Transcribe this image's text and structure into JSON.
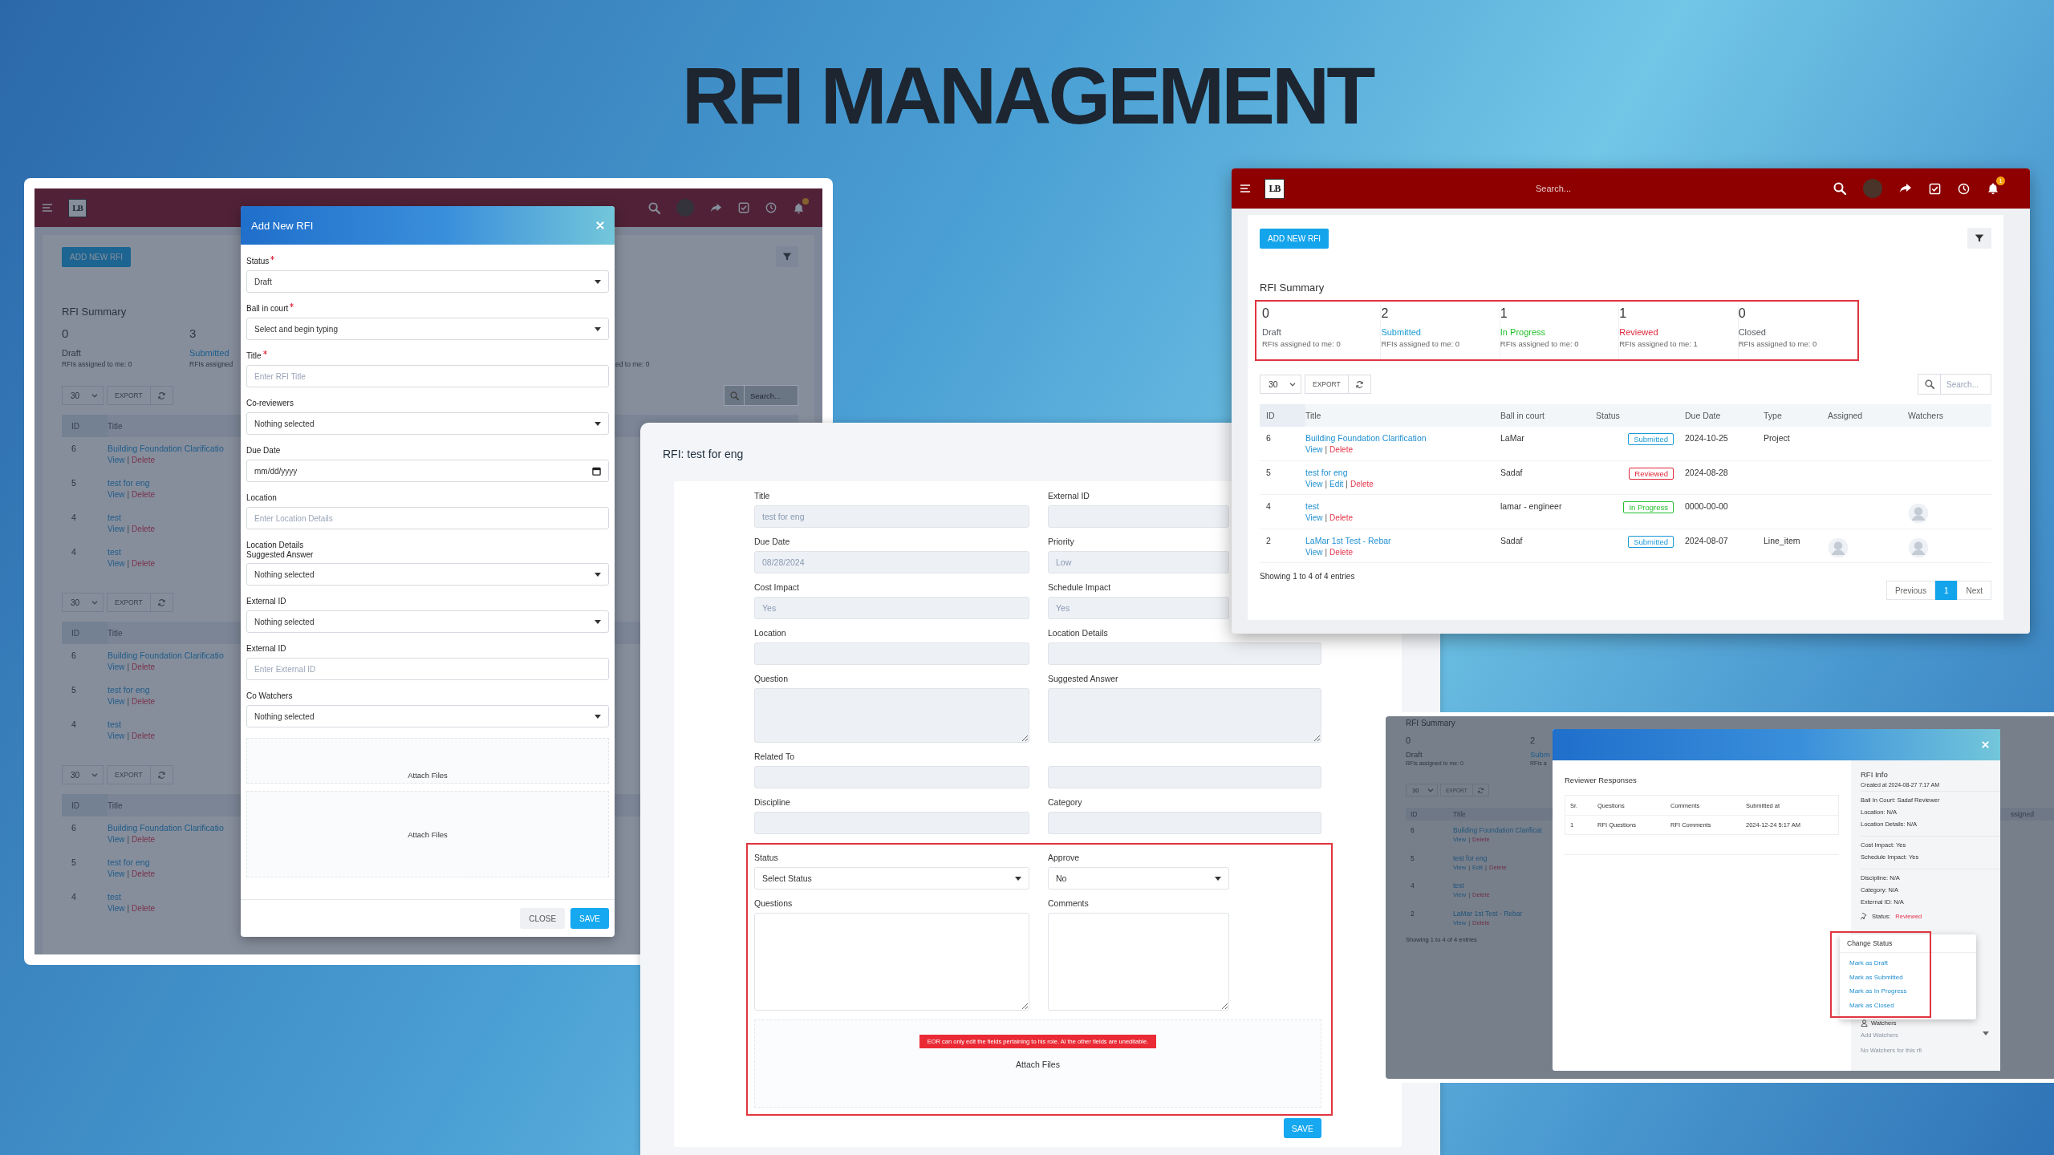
{
  "heading": "RFI MANAGEMENT",
  "add_rfi_window": {
    "header": {
      "logo": "LB"
    },
    "page": {
      "add_button": "ADD NEW RFI",
      "summary_title": "RFI Summary",
      "summary": [
        {
          "count": "0",
          "label": "Draft",
          "assigned": "RFIs assigned to me: 0",
          "color": "#2f3742"
        },
        {
          "count": "3",
          "label": "Submitted",
          "assigned": "RFIs assigned",
          "color": "#1d5c8a"
        }
      ],
      "summary_fragment": "ed to me: 0",
      "tables": [
        {
          "page_size": "30",
          "export": "EXPORT",
          "search_placeholder": "Search...",
          "columns": [
            "ID",
            "Title"
          ],
          "rows": [
            {
              "id": "6",
              "title": "Building Foundation Clarificatio",
              "actions": [
                {
                  "label": "View",
                  "kind": "view"
                },
                {
                  "label": "|",
                  "kind": "separator"
                },
                {
                  "label": "Delete",
                  "kind": "delete"
                }
              ]
            },
            {
              "id": "5",
              "title": "test for eng",
              "actions": [
                {
                  "label": "View",
                  "kind": "view"
                },
                {
                  "label": "|",
                  "kind": "separator"
                },
                {
                  "label": "Delete",
                  "kind": "delete"
                }
              ]
            },
            {
              "id": "4",
              "title": "test",
              "actions": [
                {
                  "label": "View",
                  "kind": "view"
                },
                {
                  "label": "|",
                  "kind": "separator"
                },
                {
                  "label": "Delete",
                  "kind": "delete"
                }
              ]
            },
            {
              "id": "4",
              "title": "test",
              "actions": [
                {
                  "label": "View",
                  "kind": "view"
                },
                {
                  "label": "|",
                  "kind": "separator"
                },
                {
                  "label": "Delete",
                  "kind": "delete"
                }
              ]
            }
          ]
        },
        {
          "page_size": "30",
          "export": "EXPORT",
          "columns": [
            "ID",
            "Title"
          ],
          "rows": [
            {
              "id": "6",
              "title": "Building Foundation Clarificatio",
              "actions": [
                {
                  "label": "View",
                  "kind": "view"
                },
                {
                  "label": "|",
                  "kind": "separator"
                },
                {
                  "label": "Delete",
                  "kind": "delete"
                }
              ]
            },
            {
              "id": "5",
              "title": "test for eng",
              "actions": [
                {
                  "label": "View",
                  "kind": "view"
                },
                {
                  "label": "|",
                  "kind": "separator"
                },
                {
                  "label": "Delete",
                  "kind": "delete"
                }
              ]
            },
            {
              "id": "4",
              "title": "test",
              "actions": [
                {
                  "label": "View",
                  "kind": "view"
                },
                {
                  "label": "|",
                  "kind": "separator"
                },
                {
                  "label": "Delete",
                  "kind": "delete"
                }
              ]
            }
          ]
        },
        {
          "page_size": "30",
          "export": "EXPORT",
          "columns": [
            "ID",
            "Title"
          ],
          "rows": [
            {
              "id": "6",
              "title": "Building Foundation Clarificatio",
              "actions": [
                {
                  "label": "View",
                  "kind": "view"
                },
                {
                  "label": "|",
                  "kind": "separator"
                },
                {
                  "label": "Delete",
                  "kind": "delete"
                }
              ]
            },
            {
              "id": "5",
              "title": "test for eng",
              "actions": [
                {
                  "label": "View",
                  "kind": "view"
                },
                {
                  "label": "|",
                  "kind": "separator"
                },
                {
                  "label": "Delete",
                  "kind": "delete"
                }
              ]
            },
            {
              "id": "4",
              "title": "test",
              "actions": [
                {
                  "label": "View",
                  "kind": "view"
                },
                {
                  "label": "|",
                  "kind": "separator"
                },
                {
                  "label": "Delete",
                  "kind": "delete"
                }
              ]
            }
          ]
        }
      ]
    },
    "modal": {
      "title": "Add New RFI",
      "fields": [
        {
          "kind": "select",
          "label": "Status",
          "required": true,
          "value": "Draft"
        },
        {
          "kind": "select",
          "label": "Ball in court",
          "required": true,
          "value": "Select and begin typing"
        },
        {
          "kind": "input",
          "label": "Title",
          "required": true,
          "placeholder": "Enter RFI Title"
        },
        {
          "kind": "select",
          "label": "Co-reviewers",
          "value": "Nothing selected"
        },
        {
          "kind": "date",
          "label": "Due Date",
          "value": "mm/dd/yyyy"
        },
        {
          "kind": "input",
          "label": "Location",
          "placeholder": "Enter Location Details"
        },
        {
          "kind": "select",
          "label": "Location Details",
          "extra_label": "Suggested Answer",
          "value": "Nothing selected"
        },
        {
          "kind": "select",
          "label": "External ID",
          "value": "Nothing selected"
        },
        {
          "kind": "input",
          "label": "External ID",
          "placeholder": "Enter External ID"
        },
        {
          "kind": "select",
          "label": "Co Watchers",
          "value": "Nothing selected"
        }
      ],
      "attachments": [
        "Attach Files",
        "Attach Files"
      ],
      "buttons": [
        {
          "label": "CLOSE",
          "kind": "secondary"
        },
        {
          "label": "SAVE",
          "kind": "primary"
        }
      ]
    }
  },
  "form_panel": {
    "title": "RFI: test for eng",
    "fields": [
      {
        "kind": "input",
        "label": "Title",
        "value": "test for eng",
        "disabled": true
      },
      {
        "kind": "input",
        "label": "External ID",
        "disabled": true
      },
      {
        "kind": "input",
        "label": "Due Date",
        "value": "08/28/2024",
        "disabled": true
      },
      {
        "kind": "input",
        "label": "Priority",
        "value": "Low",
        "disabled": true
      },
      {
        "kind": "input",
        "label": "Cost Impact",
        "value": "Yes",
        "disabled": true
      },
      {
        "kind": "input",
        "label": "Schedule Impact",
        "value": "Yes",
        "disabled": true
      },
      {
        "kind": "input",
        "label": "Location",
        "disabled": true
      },
      {
        "kind": "input",
        "label": "Location Details",
        "disabled": true
      },
      {
        "kind": "textarea",
        "label": "Question",
        "disabled": true
      },
      {
        "kind": "textarea",
        "label": "Suggested Answer",
        "disabled": true
      },
      {
        "kind": "input",
        "label": "Related To",
        "disabled": true
      },
      {
        "kind": "input",
        "disabled": true
      },
      {
        "kind": "input",
        "label": "Discipline",
        "disabled": true
      },
      {
        "kind": "input",
        "label": "Category",
        "disabled": true
      }
    ],
    "editable_fields": [
      {
        "kind": "select",
        "label": "Status",
        "value": "Select Status",
        "disabled": false
      },
      {
        "kind": "select",
        "label": "Approve",
        "value": "No",
        "disabled": false
      },
      {
        "kind": "textarea",
        "label": "Questions",
        "disabled": false
      },
      {
        "kind": "textarea",
        "label": "Comments",
        "disabled": false
      }
    ],
    "notice": "EOR can only edit the fields pertaining to his role. Al the other fields are uneditable.",
    "attach": "Attach Files",
    "save": "SAVE"
  },
  "info_window": {
    "page": {
      "summary_title": "RFI Summary",
      "summary": [
        {
          "count": "0",
          "label": "Draft",
          "assigned": "RFIs assigned to me: 0",
          "color": "#2f3742"
        },
        {
          "count": "2",
          "label": "Subm",
          "assigned": "RFIs a",
          "color": "#1d5c8a"
        }
      ],
      "page_size": "30",
      "export": "EXPORT",
      "columns": [
        "ID",
        "Title"
      ],
      "column_fragment": "ssigned",
      "rows": [
        {
          "id": "6",
          "title": "Building Foundation Clarificat",
          "actions": [
            {
              "label": "View",
              "kind": "view"
            },
            {
              "label": "|",
              "kind": "separator"
            },
            {
              "label": "Delete",
              "kind": "delete"
            }
          ]
        },
        {
          "id": "5",
          "title": "test for eng",
          "actions": [
            {
              "label": "View",
              "kind": "view"
            },
            {
              "label": "|",
              "kind": "separator"
            },
            {
              "label": "Edit",
              "kind": "edit"
            },
            {
              "label": "|",
              "kind": "separator"
            },
            {
              "label": "Delete",
              "kind": "delete"
            }
          ]
        },
        {
          "id": "4",
          "title": "test",
          "actions": [
            {
              "label": "View",
              "kind": "view"
            },
            {
              "label": "|",
              "kind": "separator"
            },
            {
              "label": "Delete",
              "kind": "delete"
            }
          ]
        },
        {
          "id": "2",
          "title": "LaMar 1st Test - Rebar",
          "actions": [
            {
              "label": "View",
              "kind": "view"
            },
            {
              "label": "|",
              "kind": "separator"
            },
            {
              "label": "Delete",
              "kind": "delete"
            }
          ]
        }
      ],
      "footer": "Showing 1 to 4 of 4 entries"
    },
    "modal": {
      "section_title": "Reviewer Responses",
      "columns": [
        "Sr.",
        "Questions",
        "Comments",
        "Submitted at"
      ],
      "rows": [
        [
          "1",
          "RFI Questions",
          "RFI Comments",
          "2024-12-24 5:17 AM"
        ]
      ],
      "info_title": "RFI Info",
      "created": "Created at 2024-08-27 7:17 AM",
      "info_groups": [
        [
          "Ball In Court: Sadaf Reviewer",
          "Location: N/A",
          "Location Details: N/A"
        ],
        [
          "Cost Impact: Yes",
          "Schedule Impact: Yes"
        ],
        [
          "Discipline: N/A",
          "Category: N/A",
          "External ID: N/A"
        ]
      ],
      "status_label": "Status:",
      "status": "Reviewed",
      "menu": {
        "title": "Change Status",
        "items": [
          "Mark as Draft",
          "Mark as Submitted",
          "Mark as In Progress",
          "Mark as Closed"
        ]
      },
      "watchers_title": "Watchers",
      "watchers_placeholder": "Add Watchers",
      "watchers_empty": "No Watchers for this rfi"
    }
  },
  "list_window": {
    "header": {
      "logo": "LB",
      "search_placeholder": "Search...",
      "notifications": "1"
    },
    "add_button": "ADD NEW RFI",
    "summary_title": "RFI Summary",
    "summary": [
      {
        "count": "0",
        "label": "Draft",
        "assigned": "RFIs assigned to me: 0",
        "color": "#555b63"
      },
      {
        "count": "2",
        "label": "Submitted",
        "assigned": "RFIs assigned to me: 0",
        "color": "#1a9ad6"
      },
      {
        "count": "1",
        "label": "In Progress",
        "assigned": "RFIs assigned to me: 0",
        "color": "#22c02b"
      },
      {
        "count": "1",
        "label": "Reviewed",
        "assigned": "RFIs assigned to me: 1",
        "color": "#e0283a"
      },
      {
        "count": "0",
        "label": "Closed",
        "assigned": "RFIs assigned to me: 0",
        "color": "#555b63"
      }
    ],
    "page_size": "30",
    "export": "EXPORT",
    "search_placeholder": "Search...",
    "columns": [
      "ID",
      "Title",
      "Ball in court",
      "Status",
      "Due Date",
      "Type",
      "Assigned",
      "Watchers"
    ],
    "rows": [
      {
        "id": "6",
        "title": "Building Foundation Clarification",
        "actions": [
          {
            "label": "View",
            "kind": "view"
          },
          {
            "label": "|",
            "kind": "separator"
          },
          {
            "label": "Delete",
            "kind": "delete"
          }
        ],
        "ball_in_court": "LaMar",
        "status": "Submitted",
        "color": "#1a9ad6",
        "due_date": "2024-10-25",
        "type": "Project",
        "assigned_avatar": false,
        "watcher_avatar": false
      },
      {
        "id": "5",
        "title": "test for eng",
        "actions": [
          {
            "label": "View",
            "kind": "view"
          },
          {
            "label": "|",
            "kind": "separator"
          },
          {
            "label": "Edit",
            "kind": "edit"
          },
          {
            "label": "|",
            "kind": "separator"
          },
          {
            "label": "Delete",
            "kind": "delete"
          }
        ],
        "ball_in_court": "Sadaf",
        "status": "Reviewed",
        "color": "#e0283a",
        "due_date": "2024-08-28",
        "assigned_avatar": false,
        "watcher_avatar": false
      },
      {
        "id": "4",
        "title": "test",
        "actions": [
          {
            "label": "View",
            "kind": "view"
          },
          {
            "label": "|",
            "kind": "separator"
          },
          {
            "label": "Delete",
            "kind": "delete"
          }
        ],
        "ball_in_court": "lamar - engineer",
        "status": "In Progress",
        "color": "#22c02b",
        "due_date": "0000-00-00",
        "assigned_avatar": false,
        "watcher_avatar": true
      },
      {
        "id": "2",
        "title": "LaMar 1st Test - Rebar",
        "actions": [
          {
            "label": "View",
            "kind": "view"
          },
          {
            "label": "|",
            "kind": "separator"
          },
          {
            "label": "Delete",
            "kind": "delete"
          }
        ],
        "ball_in_court": "Sadaf",
        "status": "Submitted",
        "color": "#1a9ad6",
        "due_date": "2024-08-07",
        "type": "Line_item",
        "assigned_avatar": true,
        "watcher_avatar": true
      }
    ],
    "footer": "Showing 1 to 4 of 4 entries",
    "pagination": [
      {
        "label": "Previous",
        "selected": false
      },
      {
        "label": "1",
        "selected": true
      },
      {
        "label": "Next",
        "selected": false
      }
    ]
  }
}
